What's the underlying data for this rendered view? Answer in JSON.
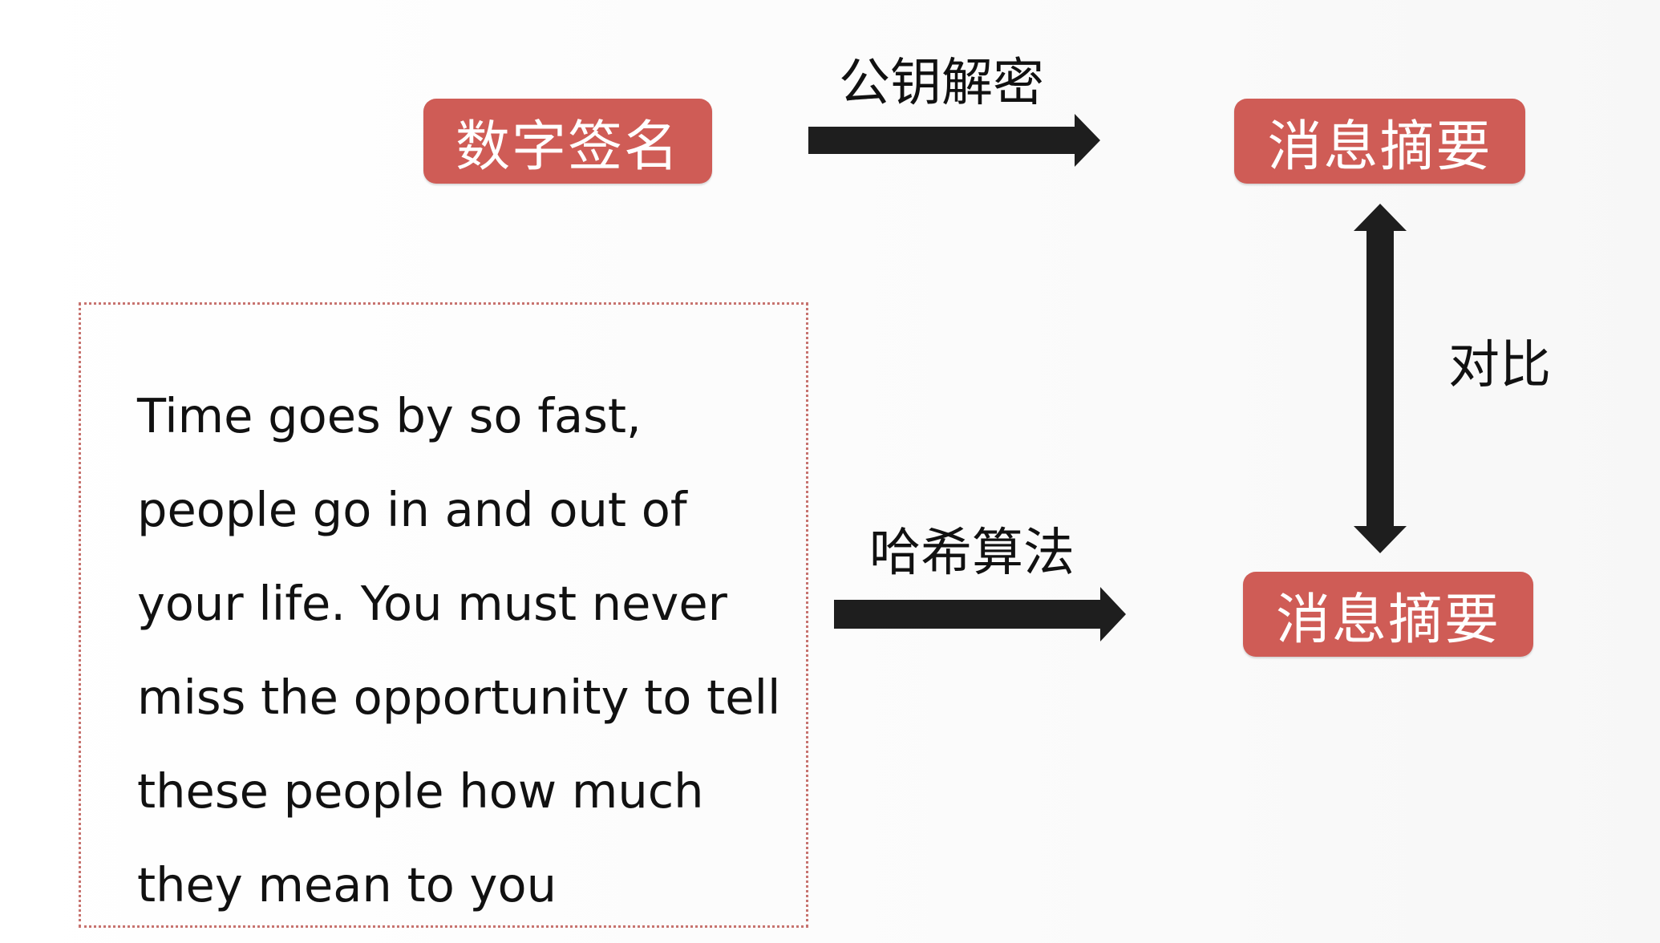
{
  "colors": {
    "node_fill": "#cf5c56",
    "arrow": "#1e1e1e",
    "border_dotted": "#c7736f",
    "text": "#111111"
  },
  "nodes": {
    "signature": "数字签名",
    "digest_top": "消息摘要",
    "digest_bottom": "消息摘要"
  },
  "edges": {
    "decrypt_label": "公钥解密",
    "hash_label": "哈希算法",
    "compare_label": "对比"
  },
  "message": {
    "text": "Time goes by so fast, people go in and out of your life. You must never miss the opportunity to tell these people how much they mean to you"
  }
}
